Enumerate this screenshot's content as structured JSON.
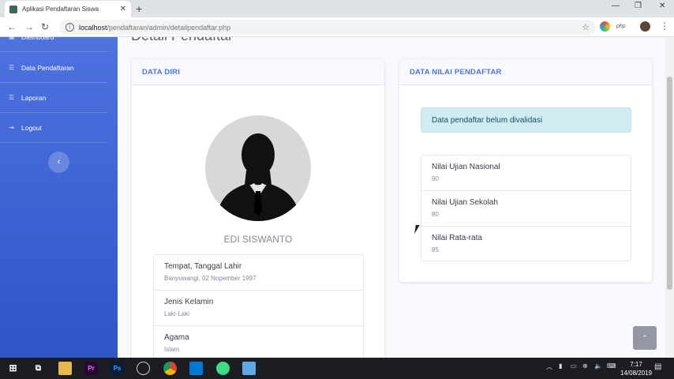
{
  "browser": {
    "tab_title": "Aplikasi Pendaftaran Siswa",
    "tab_close": "✕",
    "new_tab": "+",
    "url_host": "localhost",
    "url_path": "/pendaftaran/admin/detailpendaftar.php",
    "min": "—",
    "max": "❐",
    "close": "✕",
    "back": "←",
    "forward": "→",
    "reload": "↻",
    "star": "☆",
    "php_ext": "php"
  },
  "sidebar": {
    "items": [
      {
        "label": "Dashboard",
        "icon": "dashboard-icon"
      },
      {
        "label": "Data Pendaftaran",
        "icon": "list-icon"
      },
      {
        "label": "Laporan",
        "icon": "list-icon"
      },
      {
        "label": "Logout",
        "icon": "logout-icon"
      }
    ],
    "toggle": "‹"
  },
  "page": {
    "title": "Detail Pendaftar"
  },
  "data_diri": {
    "header": "DATA DIRI",
    "name": "EDI SISWANTO",
    "fields": [
      {
        "label": "Tempat, Tanggal Lahir",
        "value": "Banyuwangi, 02 Nopember 1997"
      },
      {
        "label": "Jenis Kelamin",
        "value": "Laki-Laki"
      },
      {
        "label": "Agama",
        "value": "Islam"
      }
    ]
  },
  "data_nilai": {
    "header": "DATA NILAI PENDAFTAR",
    "alert": "Data pendaftar belum divalidasi",
    "scores": [
      {
        "label": "Nilai Ujian Nasional",
        "value": "90"
      },
      {
        "label": "Nilai Ujian Sekolah",
        "value": "80"
      },
      {
        "label": "Nilai Rata-rata",
        "value": "85"
      }
    ]
  },
  "scroll_top": "⌃",
  "taskbar": {
    "time": "7:17",
    "date": "14/08/2019"
  },
  "colors": {
    "sidebar": "#4e73df",
    "accent": "#4e73df",
    "alert_bg": "#d1ecf1"
  }
}
